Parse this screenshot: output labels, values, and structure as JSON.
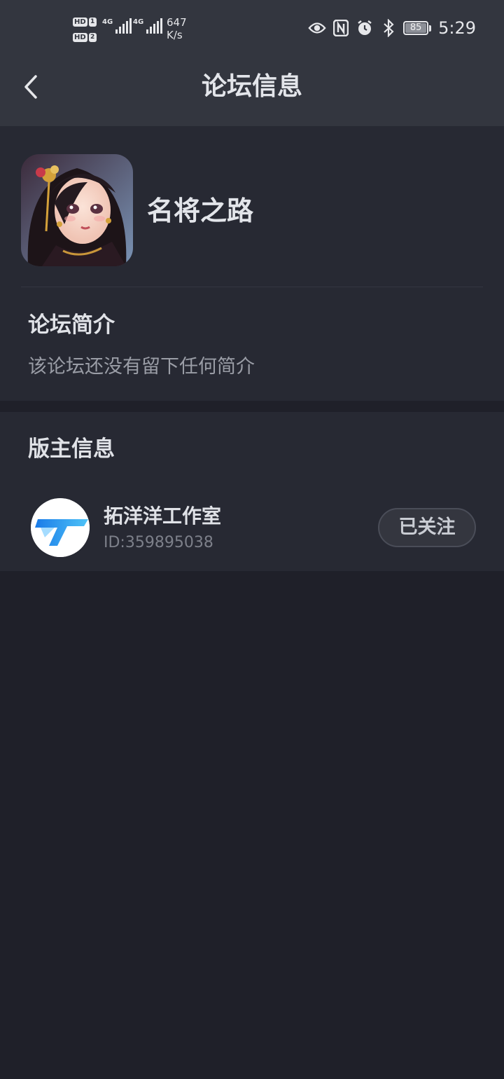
{
  "status_bar": {
    "sim1": {
      "tag": "HD",
      "num": "1"
    },
    "sim2": {
      "tag": "HD",
      "num": "2"
    },
    "net1": "4G",
    "net2": "4G",
    "speed_value": "647",
    "speed_unit": "K/s",
    "battery": "85",
    "time": "5:29",
    "icons": [
      "eye-icon",
      "nfc-icon",
      "alarm-icon",
      "bluetooth-icon"
    ]
  },
  "header": {
    "title": "论坛信息",
    "back_icon": "chevron-left-icon"
  },
  "forum": {
    "name": "名将之路",
    "intro_title": "论坛简介",
    "intro_text": "该论坛还没有留下任何简介"
  },
  "moderator": {
    "section_title": "版主信息",
    "name": "拓洋洋工作室",
    "id": "ID:359895038",
    "follow_label": "已关注"
  },
  "colors": {
    "background": "#1f2029",
    "card": "#272933",
    "topbar": "#33363f",
    "accent_blue": "#2a8cf0"
  }
}
